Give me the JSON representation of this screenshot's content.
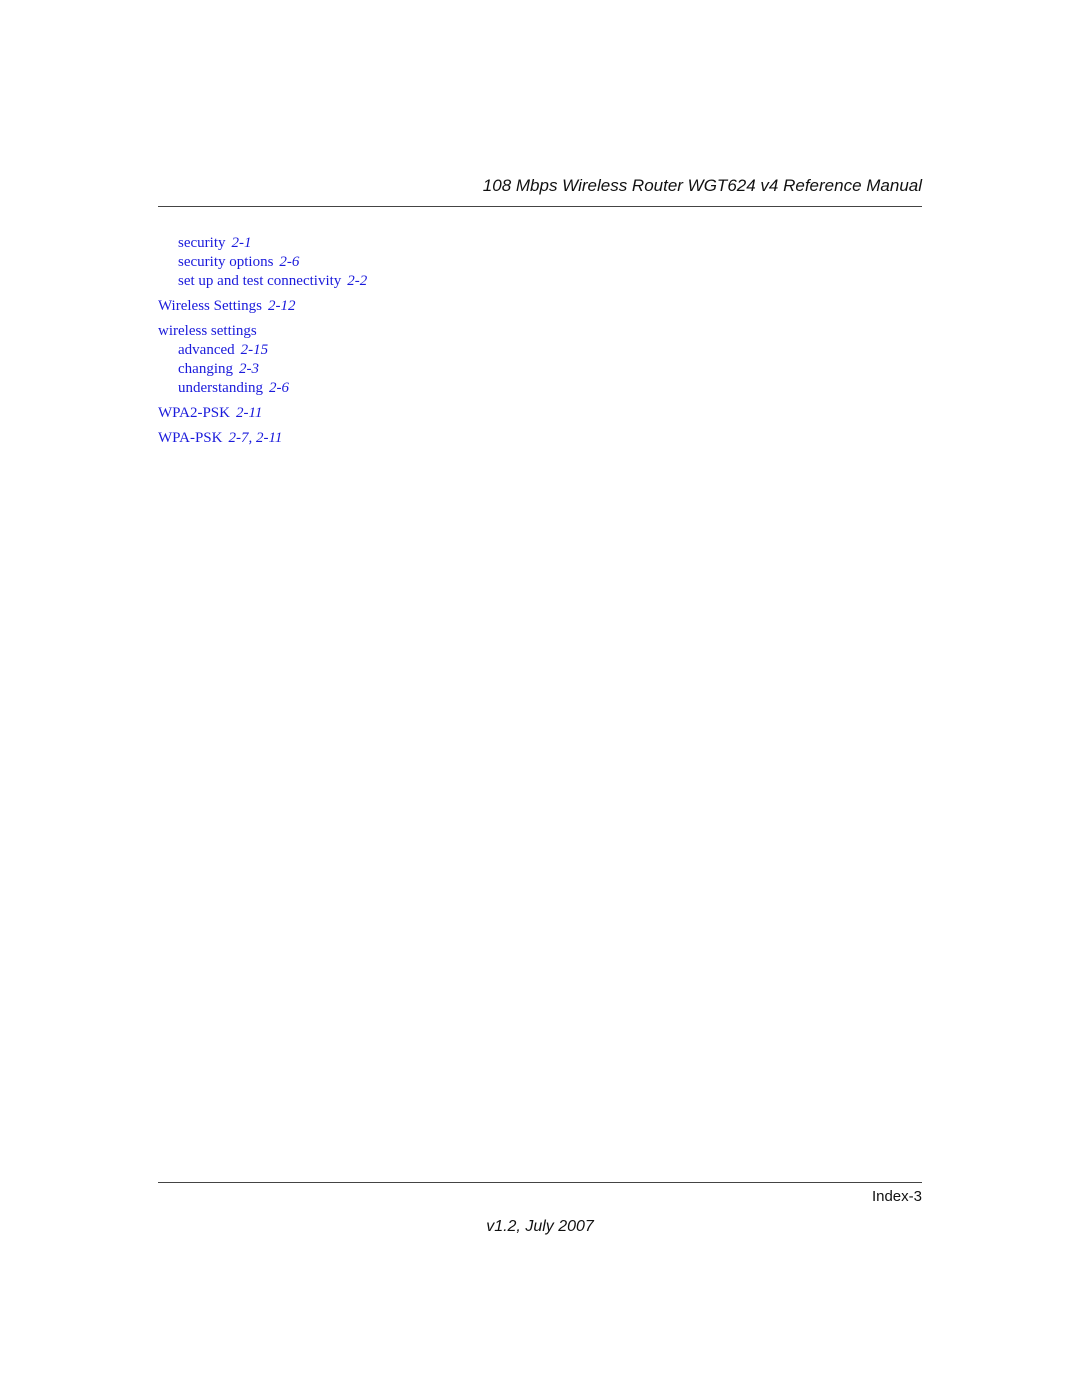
{
  "header": {
    "title": "108 Mbps Wireless Router WGT624 v4 Reference Manual"
  },
  "index_entries": [
    {
      "term": "security",
      "pages": "2-1",
      "level": 2
    },
    {
      "term": "security options",
      "pages": "2-6",
      "level": 2
    },
    {
      "term": "set up and test connectivity",
      "pages": "2-2",
      "level": 2
    },
    {
      "term": "Wireless Settings",
      "pages": "2-12",
      "level": 1
    },
    {
      "term": "wireless settings",
      "pages": "",
      "level": 1
    },
    {
      "term": "advanced",
      "pages": "2-15",
      "level": 2
    },
    {
      "term": "changing",
      "pages": "2-3",
      "level": 2
    },
    {
      "term": "understanding",
      "pages": "2-6",
      "level": 2
    },
    {
      "term": "WPA2-PSK",
      "pages": "2-11",
      "level": 1
    },
    {
      "term": "WPA-PSK",
      "pages": "2-7, 2-11",
      "level": 1
    }
  ],
  "footer": {
    "page_label": "Index-3",
    "version": "v1.2, July 2007"
  },
  "colors": {
    "link": "#1a1adb",
    "text": "#111111",
    "rule": "#444444"
  }
}
